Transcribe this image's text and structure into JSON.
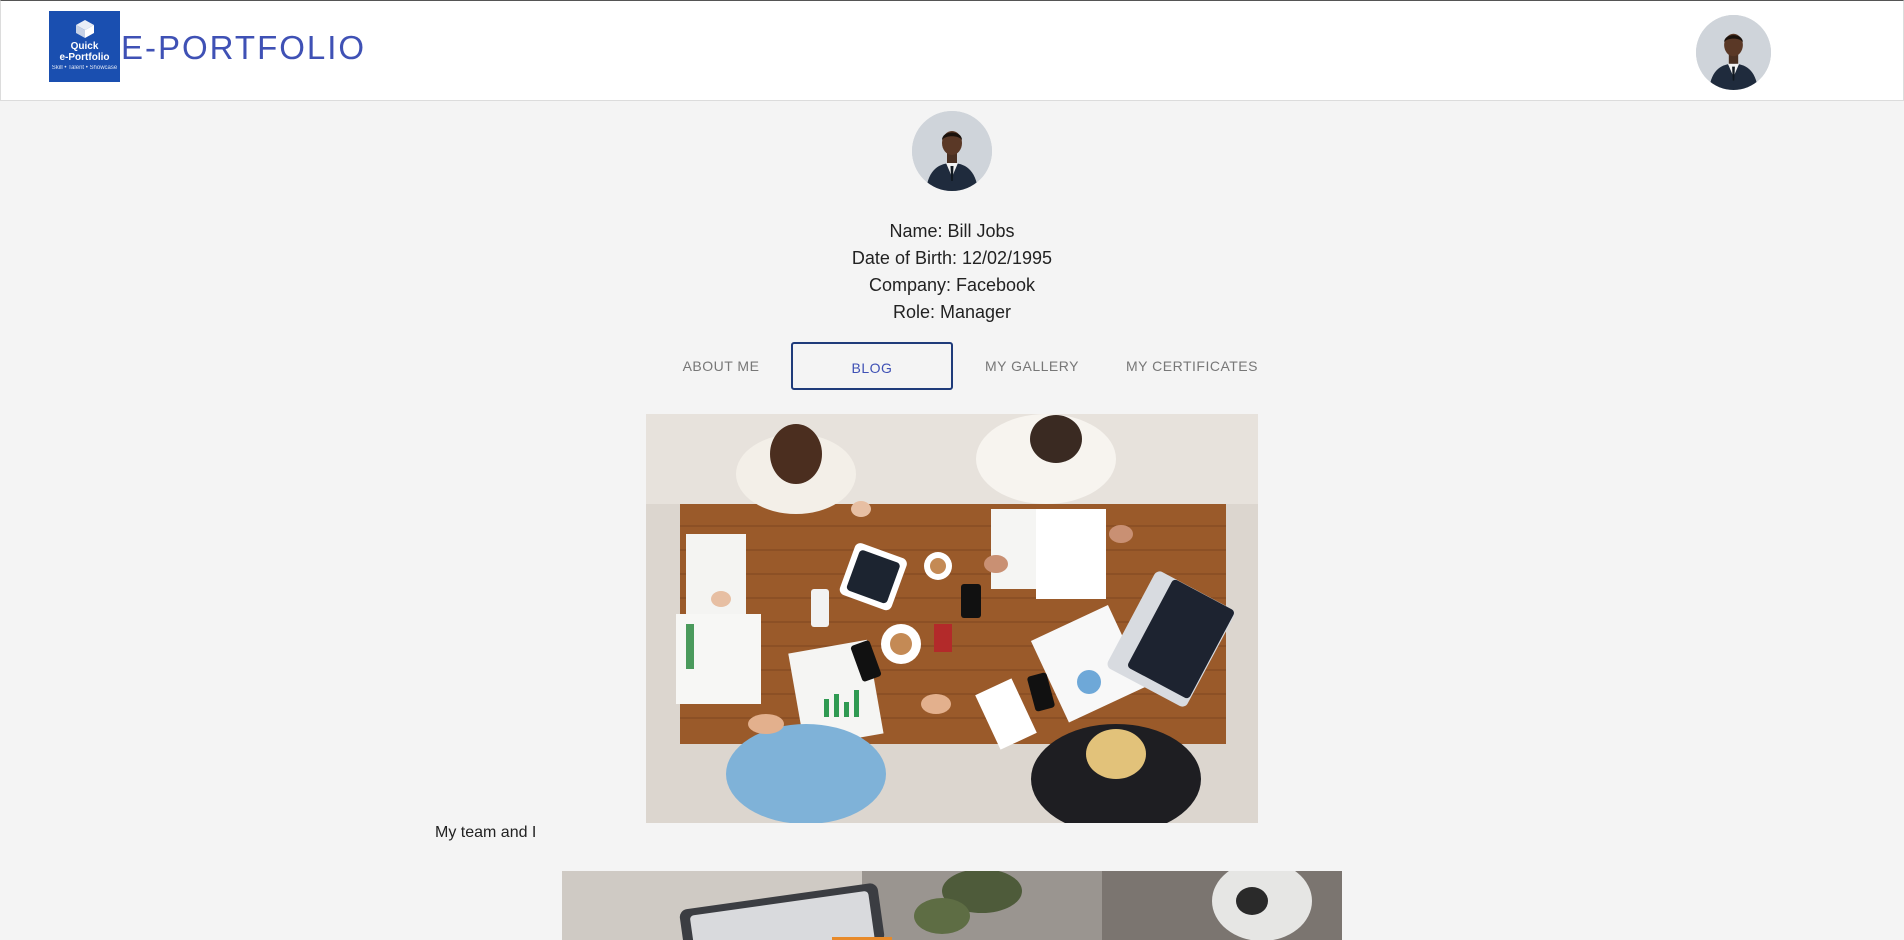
{
  "header": {
    "logo_line1": "Quick",
    "logo_line2": "e-Portfolio",
    "logo_tagline": "Skill • Talent • Showcase",
    "brand": "E-PORTFOLIO"
  },
  "profile": {
    "name": "Name: Bill Jobs",
    "dob": "Date of Birth: 12/02/1995",
    "company": "Company: Facebook",
    "role": "Role: Manager"
  },
  "tabs": [
    {
      "label": "ABOUT ME",
      "active": false
    },
    {
      "label": "BLOG",
      "active": true
    },
    {
      "label": "MY GALLERY",
      "active": false
    },
    {
      "label": "MY CERTIFICATES",
      "active": false
    }
  ],
  "blog": {
    "posts": [
      {
        "caption": "My team and I"
      }
    ]
  },
  "colors": {
    "brand": "#3f51b5",
    "logo_bg": "#1a4fb0",
    "page_bg": "#f4f4f4",
    "active_tab_border": "#1f3b7a"
  }
}
